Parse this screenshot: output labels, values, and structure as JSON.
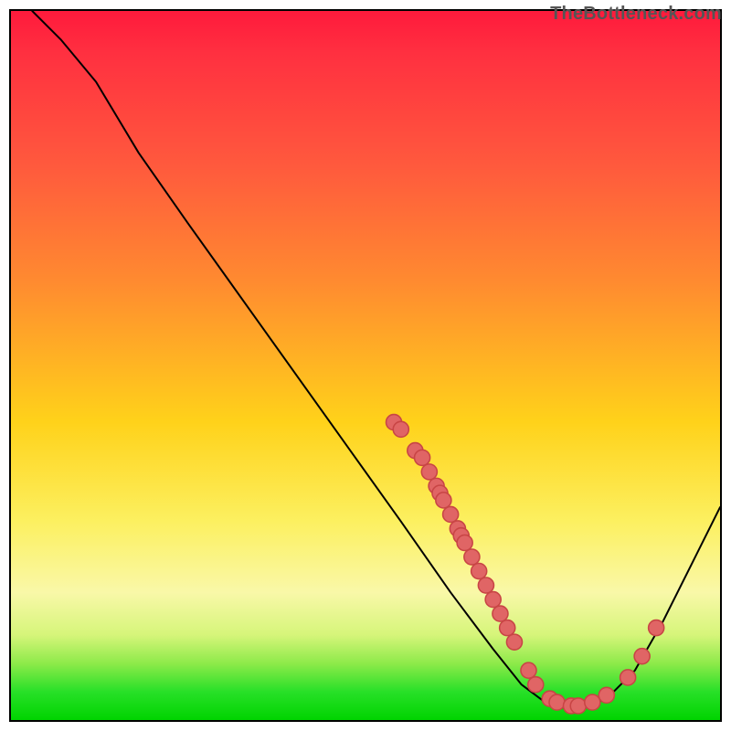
{
  "watermark": "TheBottleneck.com",
  "chart_data": {
    "type": "line",
    "title": "",
    "xlabel": "",
    "ylabel": "",
    "xlim": [
      0,
      100
    ],
    "ylim": [
      0,
      100
    ],
    "curve": {
      "name": "bottleneck-curve",
      "points": [
        {
          "x": 3,
          "y": 100
        },
        {
          "x": 7,
          "y": 96
        },
        {
          "x": 12,
          "y": 90
        },
        {
          "x": 18,
          "y": 80
        },
        {
          "x": 25,
          "y": 70
        },
        {
          "x": 35,
          "y": 56
        },
        {
          "x": 45,
          "y": 42
        },
        {
          "x": 55,
          "y": 28
        },
        {
          "x": 62,
          "y": 18
        },
        {
          "x": 68,
          "y": 10
        },
        {
          "x": 72,
          "y": 5
        },
        {
          "x": 76,
          "y": 2
        },
        {
          "x": 80,
          "y": 1.5
        },
        {
          "x": 84,
          "y": 3
        },
        {
          "x": 88,
          "y": 7
        },
        {
          "x": 92,
          "y": 14
        },
        {
          "x": 96,
          "y": 22
        },
        {
          "x": 100,
          "y": 30
        }
      ]
    },
    "series": [
      {
        "name": "gpu-data-points",
        "color": "#e06565",
        "points": [
          {
            "x": 54,
            "y": 42
          },
          {
            "x": 55,
            "y": 41
          },
          {
            "x": 57,
            "y": 38
          },
          {
            "x": 58,
            "y": 37
          },
          {
            "x": 59,
            "y": 35
          },
          {
            "x": 60,
            "y": 33
          },
          {
            "x": 60.5,
            "y": 32
          },
          {
            "x": 61,
            "y": 31
          },
          {
            "x": 62,
            "y": 29
          },
          {
            "x": 63,
            "y": 27
          },
          {
            "x": 63.5,
            "y": 26
          },
          {
            "x": 64,
            "y": 25
          },
          {
            "x": 65,
            "y": 23
          },
          {
            "x": 66,
            "y": 21
          },
          {
            "x": 67,
            "y": 19
          },
          {
            "x": 68,
            "y": 17
          },
          {
            "x": 69,
            "y": 15
          },
          {
            "x": 70,
            "y": 13
          },
          {
            "x": 71,
            "y": 11
          },
          {
            "x": 73,
            "y": 7
          },
          {
            "x": 74,
            "y": 5
          },
          {
            "x": 76,
            "y": 3
          },
          {
            "x": 77,
            "y": 2.5
          },
          {
            "x": 79,
            "y": 2
          },
          {
            "x": 80,
            "y": 2
          },
          {
            "x": 82,
            "y": 2.5
          },
          {
            "x": 84,
            "y": 3.5
          },
          {
            "x": 87,
            "y": 6
          },
          {
            "x": 89,
            "y": 9
          },
          {
            "x": 91,
            "y": 13
          }
        ]
      }
    ],
    "legend": false,
    "grid": false
  }
}
